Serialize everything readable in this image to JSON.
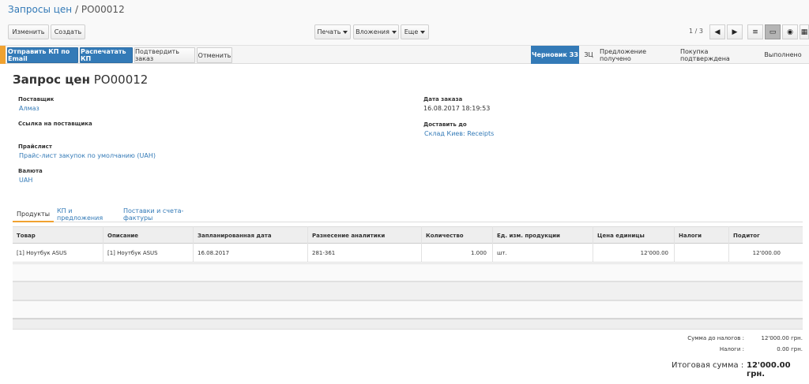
{
  "breadcrumb": {
    "parent": "Запросы цен",
    "separator": "/",
    "current": "PO00012"
  },
  "toolbar": {
    "edit_label": "Изменить",
    "create_label": "Создать",
    "print_label": "Печать",
    "attachments_label": "Вложения",
    "more_label": "Еще",
    "pager": "1 / 3"
  },
  "header_buttons": {
    "send_email": "Отправить КП по Email",
    "print_rfq": "Распечатать КП",
    "confirm_order": "Подтвердить заказ",
    "cancel": "Отменить"
  },
  "statuses": [
    {
      "label": "Черновик ЗЗ",
      "active": true
    },
    {
      "label": "ЗЦ",
      "active": false
    },
    {
      "label": "Предложение получено",
      "active": false
    },
    {
      "label": "Покупка подтверждена",
      "active": false
    },
    {
      "label": "Выполнено",
      "active": false
    }
  ],
  "form": {
    "title_label": "Запрос цен",
    "title_ref": "PO00012",
    "vendor_label": "Поставщик",
    "vendor_value": "Алмаз",
    "vendor_ref_label": "Ссылка на поставщика",
    "pricelist_label": "Прайслист",
    "pricelist_value": "Прайс-лист закупок по умолчанию (UAH)",
    "currency_label": "Валюта",
    "currency_value": "UAH",
    "order_date_label": "Дата заказа",
    "order_date_value": "16.08.2017 18:19:53",
    "deliver_to_label": "Доставить до",
    "deliver_to_value": "Склад Киев: Receipts"
  },
  "tabs": [
    {
      "label": "Продукты",
      "active": true
    },
    {
      "label": "КП и предложения",
      "active": false
    },
    {
      "label": "Поставки и счета-фактуры",
      "active": false
    }
  ],
  "table": {
    "columns": [
      "Товар",
      "Описание",
      "Запланированная дата",
      "Разнесение аналитики",
      "Количество",
      "Ед. изм. продукции",
      "Цена единицы",
      "Налоги",
      "Подитог"
    ],
    "rows": [
      [
        "[1] Ноутбук ASUS",
        "[1] Ноутбук ASUS",
        "16.08.2017",
        "281-361",
        "1.000",
        "шт.",
        "12'000.00",
        "",
        "12'000.00"
      ]
    ]
  },
  "totals": {
    "untaxed_label": "Сумма до налогов :",
    "untaxed_value": "12'000.00 грн.",
    "taxes_label": "Налоги :",
    "taxes_value": "0.00 грн.",
    "total_label": "Итоговая сумма :",
    "total_value": "12'000.00 грн."
  },
  "colors": {
    "primary": "#337ab7",
    "accent": "#f0a230"
  },
  "icons": {
    "prev": "chevron-left-icon",
    "next": "chevron-right-icon",
    "list_view": "list-icon",
    "form_view": "form-icon",
    "map_view": "map-icon",
    "calendar_view": "calendar-icon"
  }
}
